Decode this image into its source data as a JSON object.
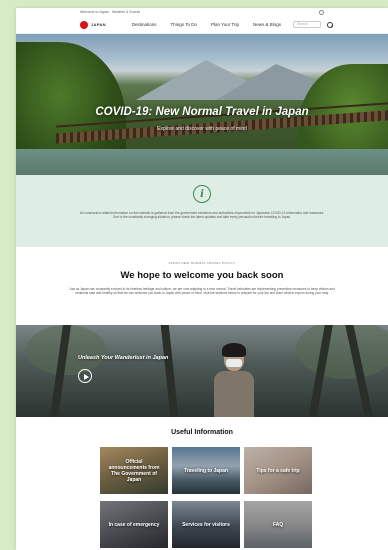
{
  "utility": {
    "text": "Welcome to Japan · Weather & Events"
  },
  "header": {
    "logo_text": "JAPAN",
    "nav": [
      "Destinations",
      "Things To Do",
      "Plan Your Trip",
      "News & Blogs"
    ],
    "search_placeholder": "Search"
  },
  "hero": {
    "title": "COVID-19: New Normal Travel in Japan",
    "subtitle": "Explore and discover with peace of mind"
  },
  "info": {
    "icon": "info-icon",
    "text": "All coronavirus-related information on this website is gathered from the government ministries and authorities responsible for Japanese COVID-19 information and measures. Due to the constantly changing situation, please check the latest updates and take every precaution before travelling to Japan."
  },
  "welcome": {
    "eyebrow": "JAPAN NEW NORMAL TRAVEL POLICY",
    "heading": "We hope to welcome you back soon",
    "body": "Just as Japan has constantly evolved in its timeless heritage and culture, we are now adapting to a new normal. Travel industries are implementing preventive measures to keep visitors and residents safe and healthy so that we can welcome you back to Japan with peace of mind. Visit the sections below to prepare for your trip and learn what to expect during your stay."
  },
  "video": {
    "title": "Unleash Your Wanderlust in Japan"
  },
  "useful": {
    "heading": "Useful Information",
    "cards": [
      "Official announcements from The Government of Japan",
      "Traveling to Japan",
      "Tips for a safe trip",
      "In case of emergency",
      "Services for visitors",
      "FAQ"
    ]
  },
  "colors": {
    "background": "#d6ecc6",
    "accent": "#d7141a",
    "info_green": "#3d8a53"
  }
}
